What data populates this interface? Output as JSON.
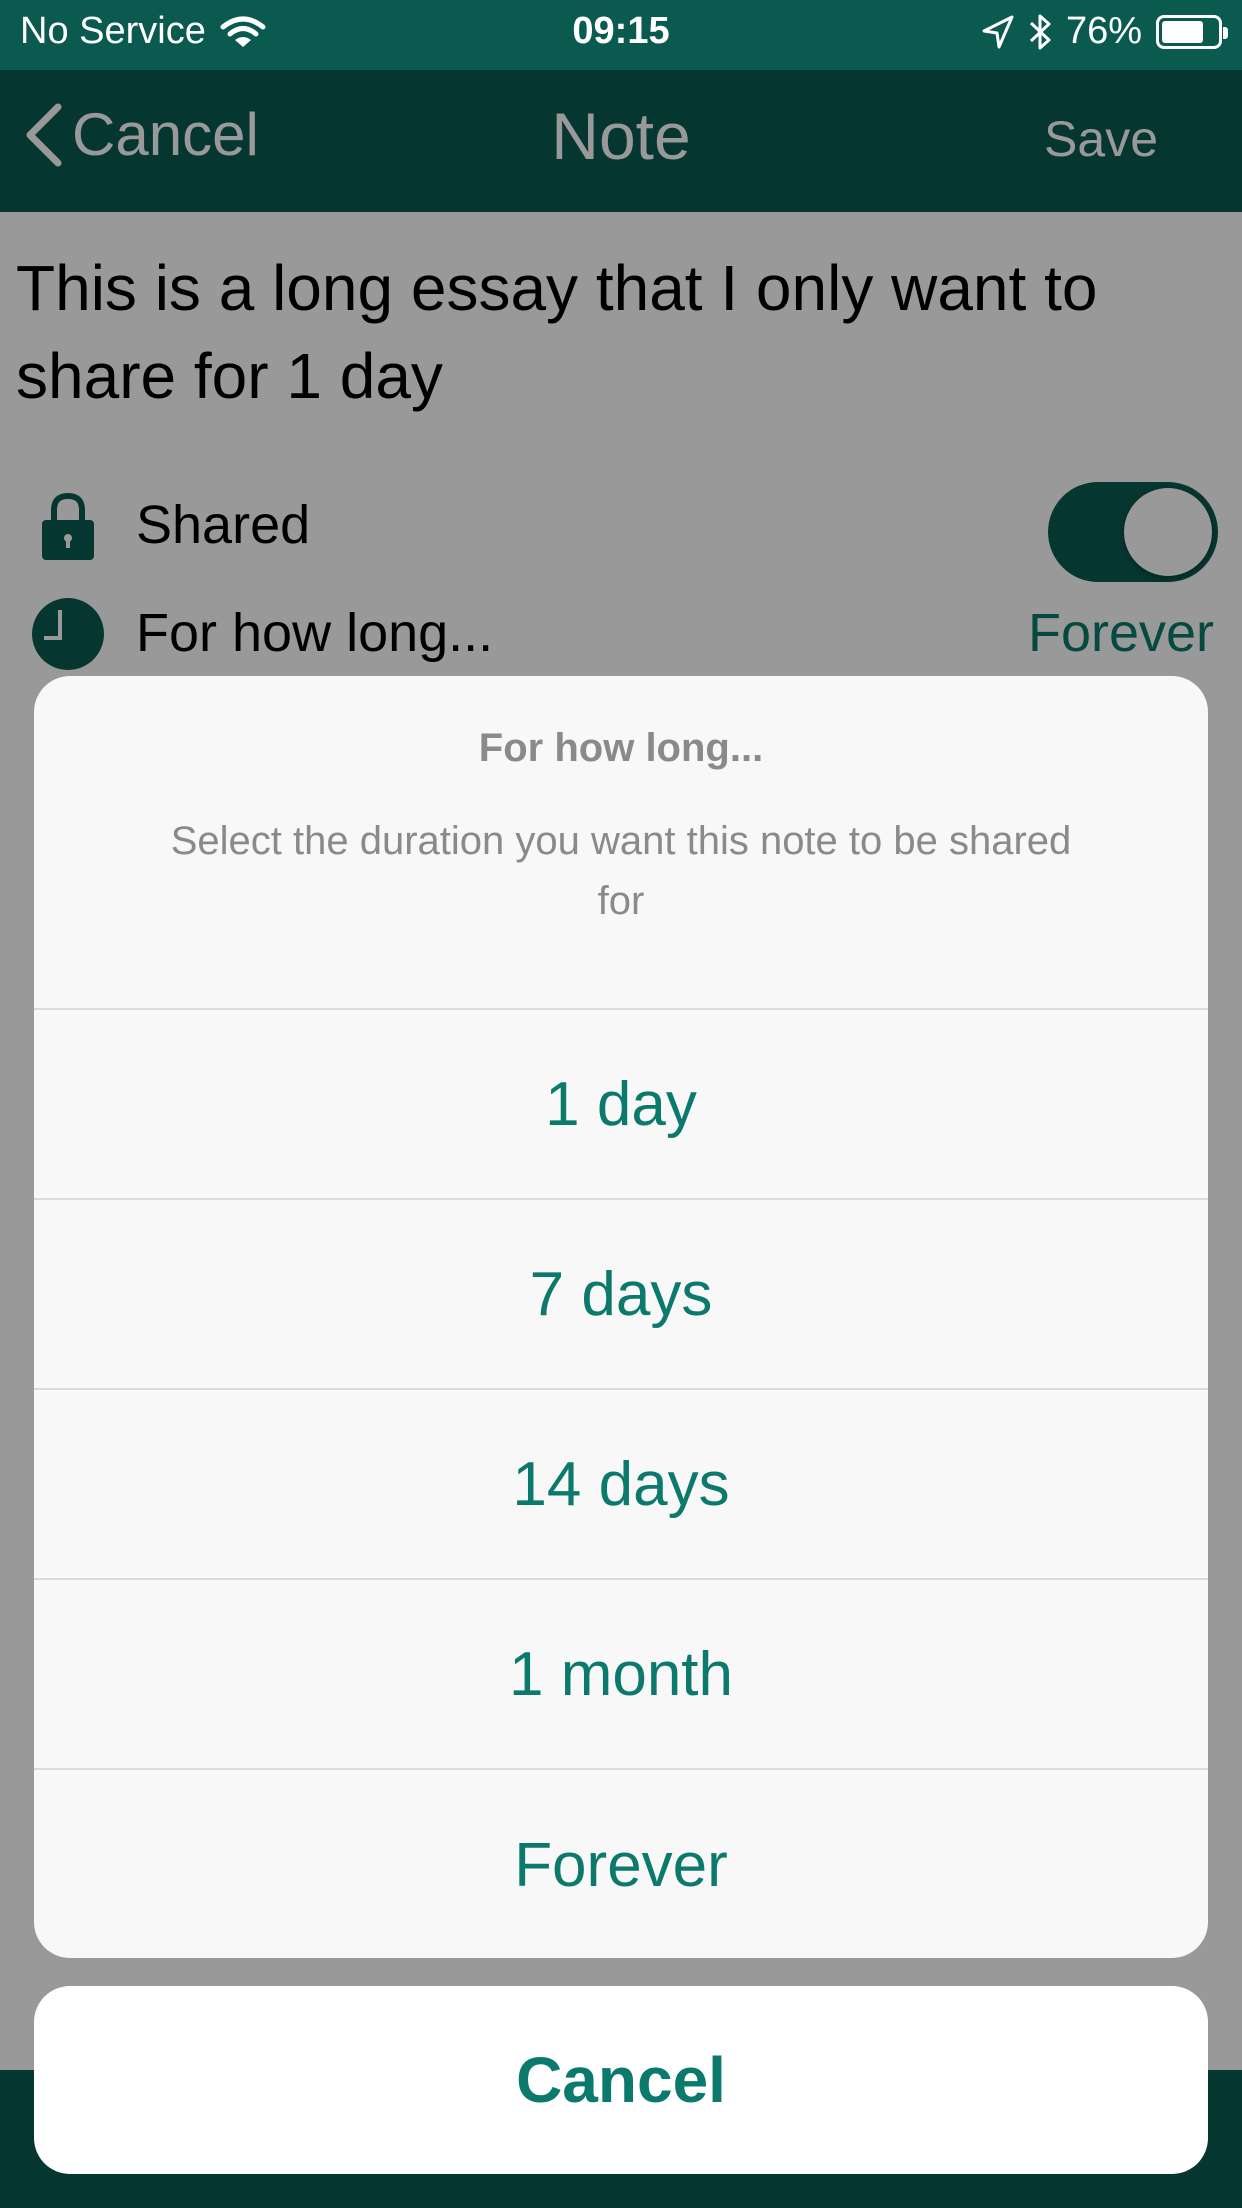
{
  "status_bar": {
    "carrier": "No Service",
    "time": "09:15",
    "battery_percent": "76%",
    "battery_level": 0.76
  },
  "nav": {
    "back_label": "Cancel",
    "title": "Note",
    "save_label": "Save"
  },
  "note": {
    "text": "This is a long essay that I only want to share for 1 day"
  },
  "shared_row": {
    "label": "Shared",
    "toggle_on": true
  },
  "duration_row": {
    "label": "For how long...",
    "value": "Forever"
  },
  "action_sheet": {
    "title": "For how long...",
    "message": "Select the duration you want this note to be shared for",
    "options": [
      "1 day",
      "7 days",
      "14 days",
      "1 month",
      "Forever"
    ],
    "cancel_label": "Cancel"
  },
  "colors": {
    "accent": "#0b7a6c",
    "brand_dark": "#0b5a50"
  }
}
